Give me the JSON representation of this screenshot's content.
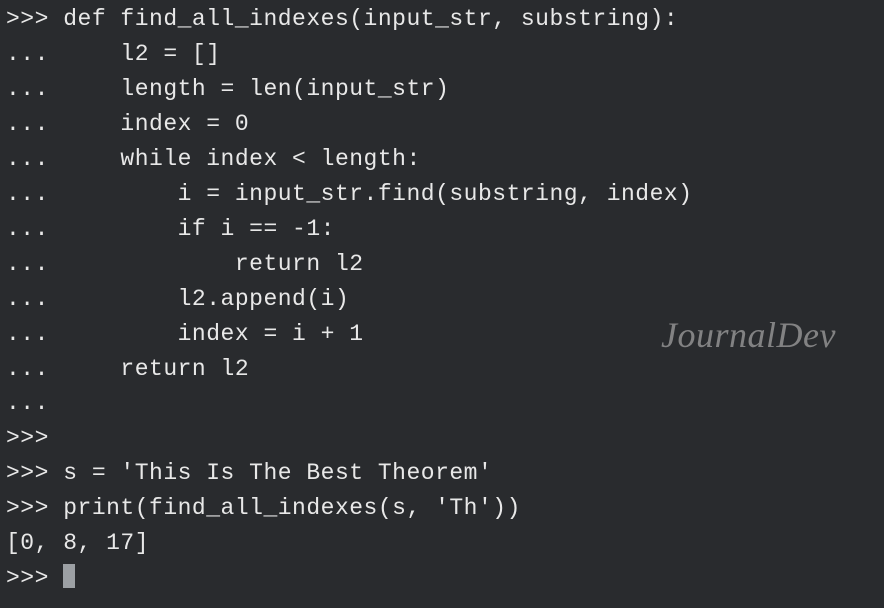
{
  "terminal": {
    "lines": [
      ">>> def find_all_indexes(input_str, substring):",
      "...     l2 = []",
      "...     length = len(input_str)",
      "...     index = 0",
      "...     while index < length:",
      "...         i = input_str.find(substring, index)",
      "...         if i == -1:",
      "...             return l2",
      "...         l2.append(i)",
      "...         index = i + 1",
      "...     return l2",
      "... ",
      ">>> ",
      ">>> s = 'This Is The Best Theorem'",
      ">>> print(find_all_indexes(s, 'Th'))",
      "[0, 8, 17]",
      ">>> "
    ],
    "watermark": "JournalDev"
  }
}
